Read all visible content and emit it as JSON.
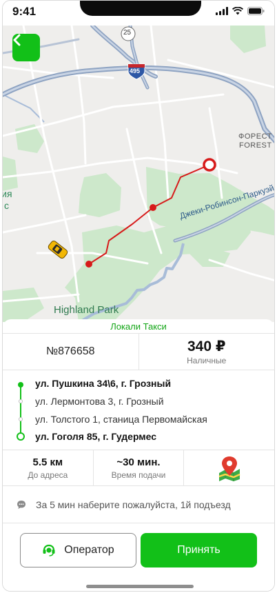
{
  "status_bar": {
    "time": "9:41"
  },
  "map": {
    "labels": {
      "interstate_25": "25",
      "interstate_495": "495",
      "forest_1": "ФОРЕСТ",
      "forest_2": "FOREST",
      "edge_1": "кия",
      "edge_2": "с",
      "highland_park": "Highland Park",
      "parkway": "Джеки-Робинсон-Паркуэй"
    }
  },
  "order": {
    "company": "Локали Такси",
    "number": "№876658",
    "price": "340 ₽",
    "payment": "Наличные"
  },
  "route": [
    {
      "address": "ул. Пушкина 34\\6, г. Грозный",
      "bold": true
    },
    {
      "address": "ул. Лермонтова 3, г. Грозный",
      "bold": false
    },
    {
      "address": "ул. Толстого 1, станица Первомайская",
      "bold": false
    },
    {
      "address": "ул. Гоголя 85, г. Гудермес",
      "bold": true
    }
  ],
  "stats": {
    "distance_value": "5.5 км",
    "distance_label": "До адреса",
    "time_value": "~30 мин.",
    "time_label": "Время подачи"
  },
  "comment": "За 5 мин наберите пожалуйста, 1й подъезд",
  "buttons": {
    "operator": "Оператор",
    "accept": "Принять"
  },
  "colors": {
    "accent": "#12c018",
    "route": "#d71a1a"
  }
}
